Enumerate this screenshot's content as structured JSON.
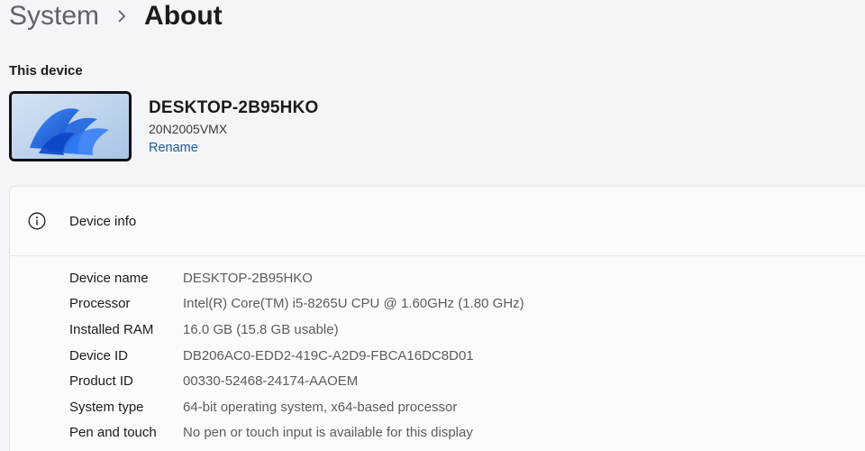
{
  "breadcrumb": {
    "parent": "System",
    "separator": "›",
    "current": "About"
  },
  "this_device": {
    "section_label": "This device",
    "name": "DESKTOP-2B95HKO",
    "model": "20N2005VMX",
    "rename_label": "Rename"
  },
  "device_info": {
    "title": "Device info",
    "rows": [
      {
        "label": "Device name",
        "value": "DESKTOP-2B95HKO"
      },
      {
        "label": "Processor",
        "value": "Intel(R) Core(TM) i5-8265U CPU @ 1.60GHz (1.80 GHz)"
      },
      {
        "label": "Installed RAM",
        "value": "16.0 GB (15.8 GB usable)"
      },
      {
        "label": "Device ID",
        "value": "DB206AC0-EDD2-419C-A2D9-FBCA16DC8D01"
      },
      {
        "label": "Product ID",
        "value": "00330-52468-24174-AAOEM"
      },
      {
        "label": "System type",
        "value": "64-bit operating system, x64-based processor"
      },
      {
        "label": "Pen and touch",
        "value": "No pen or touch input is available for this display"
      }
    ]
  },
  "icons": {
    "separator": "chevron-right-icon",
    "device_info": "info-icon",
    "thumbnail": "windows-bloom-wallpaper"
  },
  "colors": {
    "background": "#f3f5f9",
    "panel": "#fbfbfc",
    "link": "#1f5a99",
    "muted_text": "#5c5c5c"
  }
}
